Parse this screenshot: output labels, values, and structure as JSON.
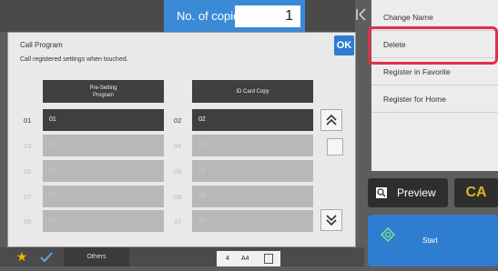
{
  "header": {
    "copies_label": "No. of copies",
    "copies_value": "1"
  },
  "right_menu": {
    "items": [
      {
        "label": "Change Name"
      },
      {
        "label": "Delete"
      },
      {
        "label": "Register in Favorite"
      },
      {
        "label": "Register for Home"
      }
    ]
  },
  "actions": {
    "preview_label": "Preview",
    "ca_label": "CA",
    "start_label": "Start"
  },
  "bottom": {
    "others_label": "Others",
    "paper_count": "4",
    "paper_size": "A4"
  },
  "dialog": {
    "title": "Call Program",
    "subtitle": "Call registered settings when touched.",
    "ok_label": "OK",
    "headers": [
      "Pre-Setting\nProgram",
      "ID Card Copy"
    ],
    "rows": [
      {
        "left_num": "01",
        "left_label": "01",
        "right_num": "02",
        "right_label": "02",
        "active": true
      },
      {
        "left_num": "03",
        "left_label": "03",
        "right_num": "04",
        "right_label": "04",
        "active": false
      },
      {
        "left_num": "05",
        "left_label": "05",
        "right_num": "06",
        "right_label": "06",
        "active": false
      },
      {
        "left_num": "07",
        "left_label": "07",
        "right_num": "08",
        "right_label": "08",
        "active": false
      },
      {
        "left_num": "09",
        "left_label": "09",
        "right_num": "10",
        "right_label": "10",
        "active": false
      }
    ]
  },
  "colors": {
    "accent_blue": "#2f7dd1",
    "highlight_red": "#e0304a",
    "ca_yellow": "#e0b520"
  }
}
